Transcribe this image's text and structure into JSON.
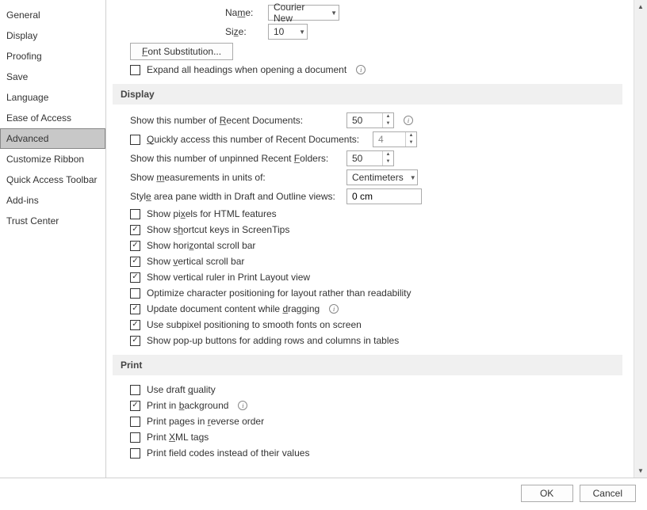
{
  "sidebar": {
    "items": [
      {
        "label": "General"
      },
      {
        "label": "Display"
      },
      {
        "label": "Proofing"
      },
      {
        "label": "Save"
      },
      {
        "label": "Language"
      },
      {
        "label": "Ease of Access"
      },
      {
        "label": "Advanced"
      },
      {
        "label": "Customize Ribbon"
      },
      {
        "label": "Quick Access Toolbar"
      },
      {
        "label": "Add-ins"
      },
      {
        "label": "Trust Center"
      }
    ],
    "selected": "Advanced"
  },
  "topFields": {
    "nameLabel": "Name:",
    "nameValue": "Courier New",
    "sizeLabel": "Size:",
    "sizeValue": "10"
  },
  "fontSubBtn": "Font Substitution...",
  "expandHeadings": {
    "label": "Expand all headings when opening a document",
    "checked": false
  },
  "sections": {
    "display": {
      "title": "Display",
      "recentDocsLabel": "Show this number of Recent Documents:",
      "recentDocsValue": "50",
      "quickAccess": {
        "label": "Quickly access this number of Recent Documents:",
        "checked": false,
        "value": "4"
      },
      "recentFoldersLabel": "Show this number of unpinned Recent Folders:",
      "recentFoldersValue": "50",
      "unitsLabel": "Show measurements in units of:",
      "unitsValue": "Centimeters",
      "styleAreaLabel": "Style area pane width in Draft and Outline views:",
      "styleAreaValue": "0 cm",
      "checks": [
        {
          "label": "Show pixels for HTML features",
          "checked": false
        },
        {
          "label": "Show shortcut keys in ScreenTips",
          "checked": true
        },
        {
          "label": "Show horizontal scroll bar",
          "checked": true
        },
        {
          "label": "Show vertical scroll bar",
          "checked": true
        },
        {
          "label": "Show vertical ruler in Print Layout view",
          "checked": true
        },
        {
          "label": "Optimize character positioning for layout rather than readability",
          "checked": false
        },
        {
          "label": "Update document content while dragging",
          "checked": true,
          "info": true
        },
        {
          "label": "Use subpixel positioning to smooth fonts on screen",
          "checked": true
        },
        {
          "label": "Show pop-up buttons for adding rows and columns in tables",
          "checked": true
        }
      ]
    },
    "print": {
      "title": "Print",
      "checks": [
        {
          "label": "Use draft quality",
          "checked": false
        },
        {
          "label": "Print in background",
          "checked": true,
          "info": true
        },
        {
          "label": "Print pages in reverse order",
          "checked": false
        },
        {
          "label": "Print XML tags",
          "checked": false
        },
        {
          "label": "Print field codes instead of their values",
          "checked": false
        }
      ]
    }
  },
  "footer": {
    "ok": "OK",
    "cancel": "Cancel"
  }
}
